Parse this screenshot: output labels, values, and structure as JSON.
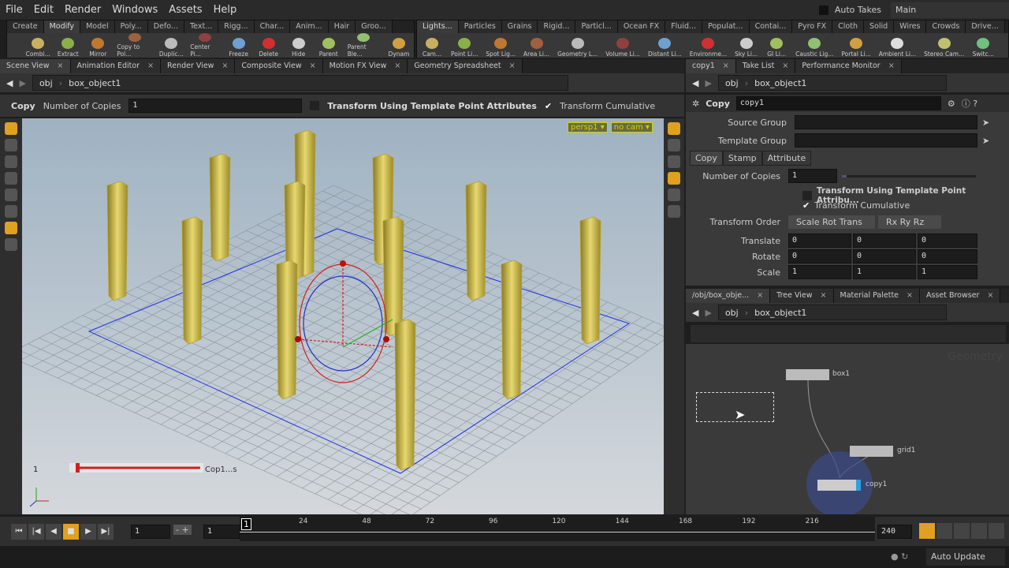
{
  "menu": [
    "File",
    "Edit",
    "Render",
    "Windows",
    "Assets",
    "Help"
  ],
  "auto_takes": "Auto Takes",
  "desktop": "Main",
  "shelf_left": {
    "tabs": [
      "Create",
      "Modify",
      "Model",
      "Poly...",
      "Defo...",
      "Text...",
      "Rigg...",
      "Char...",
      "Anim...",
      "Hair",
      "Groo..."
    ],
    "tools": [
      "Combi...",
      "Extract",
      "Mirror",
      "Copy to Pol...",
      "Duplic...",
      "Center Pi...",
      "Freeze",
      "Delete",
      "Hide",
      "Parent",
      "Parent Ble...",
      "Dynam"
    ]
  },
  "shelf_right": {
    "tabs": [
      "Lights...",
      "Particles",
      "Grains",
      "Rigid...",
      "Particl...",
      "Ocean FX",
      "Fluid...",
      "Populat...",
      "Contai...",
      "Pyro FX",
      "Cloth",
      "Solid",
      "Wires",
      "Crowds",
      "Drive..."
    ],
    "tools": [
      "Cam...",
      "Point Li...",
      "Spot Lig...",
      "Area Li...",
      "Geometry L...",
      "Volume Li...",
      "Distant Li...",
      "Environme...",
      "Sky Li...",
      "GI Li...",
      "Caustic Lig...",
      "Portal Li...",
      "Ambient Li...",
      "Stereo Cam...",
      "Switc..."
    ]
  },
  "colors": {
    "accent": "#e0a020",
    "yellow_label": "#d8d000"
  },
  "left_pane": {
    "tabs": [
      "Scene View",
      "Animation Editor",
      "Render View",
      "Composite View",
      "Motion FX View",
      "Geometry Spreadsheet"
    ],
    "path": [
      "obj",
      "box_object1"
    ]
  },
  "op_toolbar": {
    "name": "Copy",
    "num_copies_label": "Number of Copies",
    "num_copies": "1",
    "template_attr": "Transform Using Template Point Attributes",
    "cumulative": "Transform Cumulative"
  },
  "viewport": {
    "camera": "persp1 ▾",
    "cam": "no cam ▾",
    "handle_value": "1",
    "handle_label": "Cop1...s"
  },
  "right_pane": {
    "tabs": [
      "copy1",
      "Take List",
      "Performance Monitor"
    ],
    "path": [
      "obj",
      "box_object1"
    ]
  },
  "parms": {
    "type": "Copy",
    "node": "copy1",
    "source_group": "Source Group",
    "template_group": "Template Group",
    "tabs": [
      "Copy",
      "Stamp",
      "Attribute"
    ],
    "num_copies_label": "Number of Copies",
    "num_copies": "1",
    "template_attr": "Transform Using Template Point Attribu...",
    "cumulative": "Transform Cumulative",
    "order_label": "Transform Order",
    "order": "Scale Rot Trans",
    "rot_order": "Rx Ry Rz",
    "translate_label": "Translate",
    "translate": [
      "0",
      "0",
      "0"
    ],
    "rotate_label": "Rotate",
    "rotate": [
      "0",
      "0",
      "0"
    ],
    "scale_label": "Scale",
    "scale": [
      "1",
      "1",
      "1"
    ]
  },
  "network": {
    "tabs": [
      "/obj/box_obje...",
      "Tree View",
      "Material Palette",
      "Asset Browser"
    ],
    "path": [
      "obj",
      "box_object1"
    ],
    "watermark": "Geometry",
    "nodes": [
      "box1",
      "grid1",
      "copy1"
    ]
  },
  "timeline": {
    "current": "1",
    "start": "1",
    "step": "1",
    "ticks": [
      "24",
      "48",
      "72",
      "96",
      "120",
      "144",
      "168",
      "192",
      "216"
    ],
    "frame": "1",
    "end": "240"
  },
  "status": {
    "auto_update": "Auto Update"
  }
}
